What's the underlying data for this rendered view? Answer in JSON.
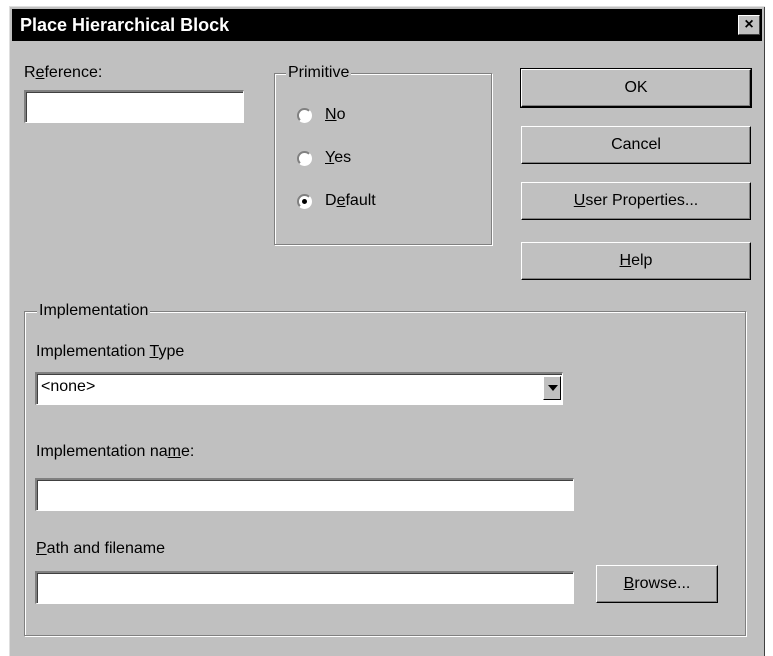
{
  "dialog": {
    "title": "Place Hierarchical Block",
    "close_symbol": "×"
  },
  "reference": {
    "label_pre": "R",
    "label_accel": "e",
    "label_post": "ference:",
    "value": ""
  },
  "primitive": {
    "title": "Primitive",
    "options": [
      {
        "accel": "N",
        "rest": "o",
        "pre": "",
        "selected": false
      },
      {
        "accel": "Y",
        "rest": "es",
        "pre": "",
        "selected": false
      },
      {
        "pre": "D",
        "accel": "e",
        "rest": "fault",
        "selected": true
      }
    ]
  },
  "buttons": {
    "ok": "OK",
    "cancel": "Cancel",
    "user_properties_accel": "U",
    "user_properties_rest": "ser Properties...",
    "help_accel": "H",
    "help_rest": "elp",
    "browse_accel": "B",
    "browse_rest": "rowse..."
  },
  "implementation": {
    "title": "Implementation",
    "type_label_pre": "Implementation ",
    "type_label_accel": "T",
    "type_label_post": "ype",
    "type_selected": "<none>",
    "name_label_pre": "Implementation na",
    "name_label_accel": "m",
    "name_label_post": "e:",
    "name_value": "",
    "path_label_accel": "P",
    "path_label_rest": "ath and filename",
    "path_value": ""
  }
}
